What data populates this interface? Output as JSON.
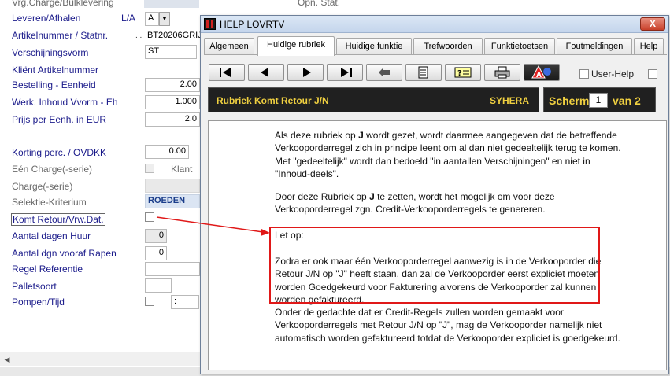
{
  "form": {
    "rows": [
      {
        "label": "Vrg.Charge/Bulklevering",
        "style": "grey"
      },
      {
        "label": "Leveren/Afhalen",
        "extra": "L/A",
        "value": "A"
      },
      {
        "label": "Artikelnummer / Statnr.",
        "value": "BT20206GRIJ"
      },
      {
        "label": "Verschijningsvorm",
        "value": "ST"
      },
      {
        "label": "Kliënt Artikelnummer"
      },
      {
        "label": "Bestelling - Eenheid",
        "value": "2.00"
      },
      {
        "label": "Werk. Inhoud Vvorm - Eh",
        "value": "1.000"
      },
      {
        "label": "Prijs per Eenh. in EUR",
        "value": "2.0"
      },
      {
        "label": "Korting perc. / OVDKK",
        "value": "0.00"
      },
      {
        "label": "Eén Charge(-serie)",
        "extra": "Klant"
      },
      {
        "label": "Charge(-serie)"
      },
      {
        "label": "Selektie-Kriterium",
        "value": "ROEDEN"
      },
      {
        "label": "Komt Retour/Vrw.Dat."
      },
      {
        "label": "Aantal dagen Huur",
        "value": "0"
      },
      {
        "label": "Aantal dgn vooraf Rapen",
        "value": "0"
      },
      {
        "label": "Regel Referentie"
      },
      {
        "label": "Palletsoort"
      },
      {
        "label": "Pompen/Tijd",
        "value": ":"
      }
    ],
    "top_right_fragment": "Opn. Stat."
  },
  "help_window": {
    "title": "HELP LOVRTV",
    "close_label": "X",
    "tabs": [
      "Algemeen",
      "Huidige rubriek",
      "Huidige funktie",
      "Trefwoorden",
      "Funktietoetsen",
      "Foutmeldingen",
      "Help"
    ],
    "active_tab": "Huidige rubriek",
    "user_help_label": "User-Help",
    "rubriek_title": "Rubriek Komt Retour J/N",
    "rubriek_code": "SYHERA",
    "scherm_label": "Scherm",
    "scherm_number": "1",
    "scherm_total": "van 2",
    "paragraphs": [
      [
        "Als deze rubriek op ",
        "J",
        " wordt gezet, wordt daarmee aangegeven dat de betreffende Verkooporderregel zich in principe leent om al dan niet gedeeltelijk terug te komen. Met \"gedeeltelijk\" wordt dan bedoeld \"in aantallen Verschijningen\" en niet in \"Inhoud-deels\"."
      ],
      [
        "Door deze Rubriek op ",
        "J",
        " te zetten, wordt het mogelijk om voor deze Verkooporderregel zgn. Credit-Verkooporderregels te genereren."
      ],
      [
        "Let op:"
      ],
      [
        "Zodra er ook maar één Verkooporderregel aanwezig is in de Verkooporder die Retour J/N op \"J\" heeft staan, dan zal de Verkooporder eerst expliciet moeten worden Goedgekeurd voor Fakturering alvorens de Verkooporder zal kunnen worden gefaktureerd."
      ],
      [
        "Onder de gedachte dat er Credit-Regels zullen worden gemaakt voor Verkooporderregels met Retour J/N op \"J\", mag de Verkooporder namelijk niet automatisch worden gefaktureerd totdat de Verkooporder expliciet is goedgekeurd."
      ]
    ]
  },
  "colors": {
    "annotation_red": "#e01818",
    "panel_bg": "#202020",
    "panel_text": "#f0d040"
  }
}
